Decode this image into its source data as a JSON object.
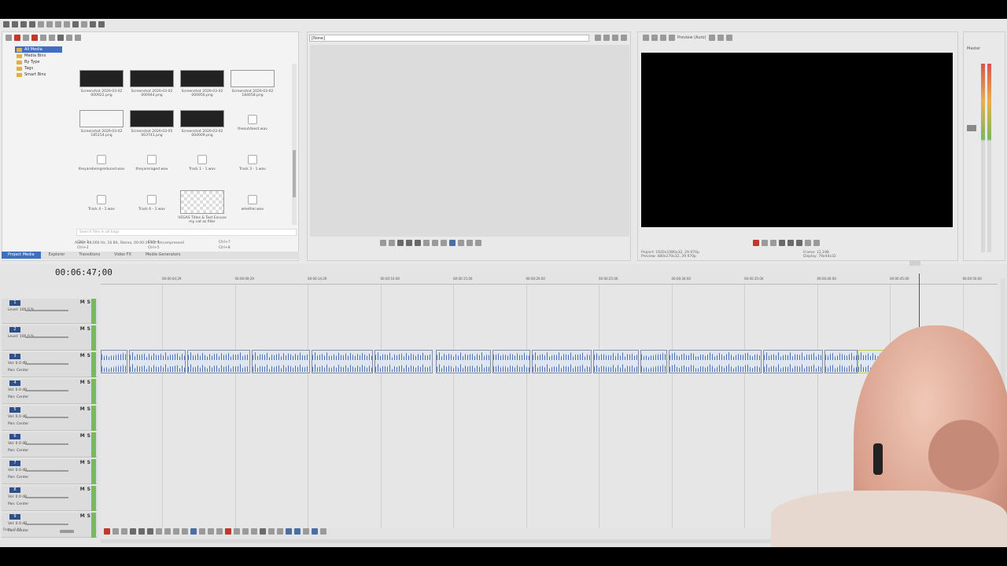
{
  "media_tree": [
    "All Media",
    "Media Bins",
    "By Type",
    "Tags",
    "Smart Bins"
  ],
  "media_items": [
    {
      "name": "Screenshot 2026-03-02 000922.png",
      "kind": "img"
    },
    {
      "name": "Screenshot 2026-03-02 000944.png",
      "kind": "img"
    },
    {
      "name": "Screenshot 2026-03-02 000956.png",
      "kind": "img"
    },
    {
      "name": "Screenshot 2026-03-02 184658.png",
      "kind": "img-w"
    },
    {
      "name": "Screenshot 2026-03-02 185154.png",
      "kind": "img-w"
    },
    {
      "name": "Screenshot 2026-03-05 003741.png",
      "kind": "img"
    },
    {
      "name": "Screenshot 2026-03-02 004009.png",
      "kind": "img"
    },
    {
      "name": "theoutdoest.wav",
      "kind": "aud"
    },
    {
      "name": "theyarebeingreduced.wav",
      "kind": "aud"
    },
    {
      "name": "theyareraged.wav",
      "kind": "aud"
    },
    {
      "name": "Track 1 - 1.wav",
      "kind": "aud"
    },
    {
      "name": "Track 3 - 1.wav",
      "kind": "aud"
    },
    {
      "name": "Track 4 - 1.wav",
      "kind": "aud"
    },
    {
      "name": "Track 6 - 1.wav",
      "kind": "aud"
    },
    {
      "name": "VEGAS Titles & Text Excuse my cat as filler",
      "kind": "ck"
    },
    {
      "name": "whether.wav",
      "kind": "aud"
    }
  ],
  "search_placeholder": "Search files in all bags",
  "shortcuts": [
    "Ctrl+1",
    "Ctrl+4",
    "Ctrl+7",
    "Ctrl+2",
    "Ctrl+5",
    "Ctrl+8",
    "Ctrl+3",
    "Ctrl+6",
    "Ctrl"
  ],
  "media_info": "Audio: 48,000 Hz, 16 Bit, Stereo, 00:00:19,02, Uncompressed",
  "tabs": [
    "Project Media",
    "Explorer",
    "Transitions",
    "Video FX",
    "Media Generators"
  ],
  "trimmer_select": "[None]",
  "preview_quality": "Preview (Auto)",
  "preview_info": {
    "project": "Project: 1920x1080x32, 29.970p",
    "preview": "Preview: 480x270x32, 29.970p",
    "frame": "Frame: 12,198",
    "display": "Display: 79x44x32"
  },
  "mixer_label": "Master",
  "timecode": "00:06:47;00",
  "ruler_marks": [
    "00:00:04;29",
    "00:00:09;29",
    "00:00:14;29",
    "00:00:10:00",
    "00:00:15:00",
    "00:00:20:00",
    "00:00:25:00",
    "00:00:30:00",
    "00:00:35:00",
    "00:00:40:00",
    "00:00:45:00",
    "00:00:50:00"
  ],
  "tracks": [
    {
      "num": "1",
      "line1": "Level: 100.0 %",
      "line2": ""
    },
    {
      "num": "2",
      "line1": "Level: 100.0 %",
      "line2": ""
    },
    {
      "num": "3",
      "line1": "Vol: 0.0 dB",
      "line2": "Pan: Center"
    },
    {
      "num": "4",
      "line1": "Vol: 0.0 dB",
      "line2": "Pan: Center"
    },
    {
      "num": "5",
      "line1": "Vol: 0.0 dB",
      "line2": "Pan: Center"
    },
    {
      "num": "6",
      "line1": "Vol: 0.0 dB",
      "line2": "Pan: Center"
    },
    {
      "num": "7",
      "line1": "Vol: 0.0 dB",
      "line2": "Pan: Center"
    },
    {
      "num": "8",
      "line1": "Vol: 0.0 dB",
      "line2": "Pan: Center"
    },
    {
      "num": "9",
      "line1": "Vol: 0.0 dB",
      "line2": "Pan: Center"
    }
  ],
  "touch_label": "Touch",
  "rate_label": "Rate: 0.00",
  "webcam": "webcam overlay"
}
